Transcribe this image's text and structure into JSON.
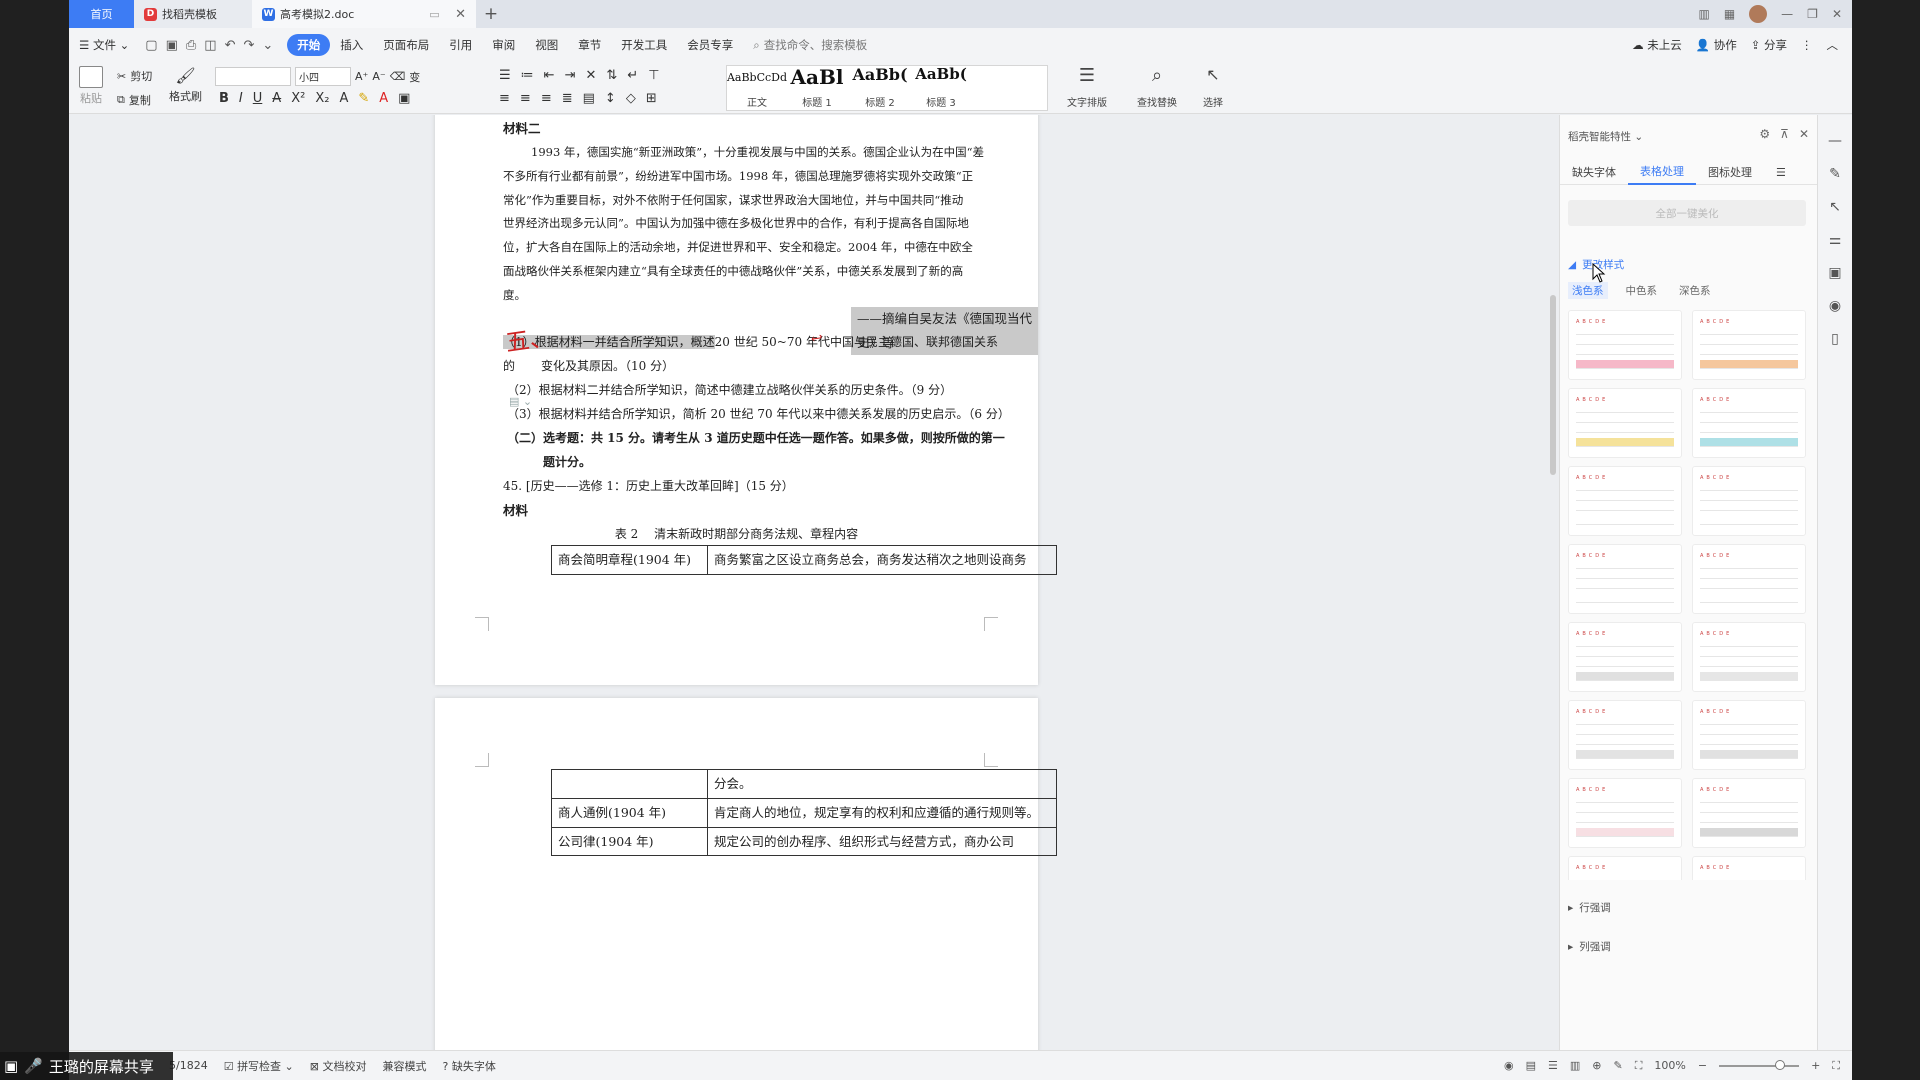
{
  "tabs": {
    "home": "首页",
    "tab1": "找稻壳模板",
    "tab2": "高考模拟2.doc"
  },
  "menu": {
    "file": "文件",
    "items": [
      "开始",
      "插入",
      "页面布局",
      "引用",
      "审阅",
      "视图",
      "章节",
      "开发工具",
      "会员专享"
    ],
    "search_placeholder": "查找命令、搜索模板",
    "cloud": "未上云",
    "collab": "协作",
    "share": "分享"
  },
  "ribbon": {
    "paste": "粘贴",
    "cut": "剪切",
    "copy": "复制",
    "format_painter": "格式刷",
    "font_size": "小四",
    "styles": [
      {
        "preview": "AaBbCcDd",
        "label": "正文"
      },
      {
        "preview": "AaBl",
        "label": "标题 1"
      },
      {
        "preview": "AaBb(",
        "label": "标题 2"
      },
      {
        "preview": "AaBb(",
        "label": "标题 3"
      }
    ],
    "text_layout": "文字排版",
    "find_replace": "查找替换",
    "select": "选择"
  },
  "document": {
    "material2_title": "材料二",
    "material2_lines": [
      "1993 年，德国实施“新亚洲政策”，十分重视发展与中国的关系。德国企业认为在中国“差",
      "不多所有行业都有前景”，纷纷进军中国市场。1998 年，德国总理施罗德将实现外交政策“正",
      "常化”作为重要目标，对外不依附于任何国家，谋求世界政治大国地位，并与中国共同“推动",
      "世界经济出现多元认同”。中国认为加强中德在多极化世界中的合作，有利于提高各自国际地",
      "位，扩大各自在国际上的活动余地，并促进世界和平、安全和稳定。2004 年，中德在中欧全",
      "面战略伙伴关系框架内建立“具有全球责任的中德战略伙伴”关系，中德关系发展到了新的高",
      "度。"
    ],
    "source": "——摘编自吴友法《德国现当代史》等",
    "q1_a": "（1）根据材料一并结合所学知识，概述",
    "q1_b": "20 世纪 50~70 年代中国与民主德国、联邦德国关系的",
    "q1_c": "变化及其原因。（10 分）",
    "q2": "（2）根据材料二并结合所学知识，简述中德建立战略伙伴关系的历史条件。（9 分）",
    "q3": "（3）根据材料并结合所学知识，简析 20 世纪 70 年代以来中德关系发展的历史启示。（6 分）",
    "elective_a": "（二）选考题：共 15 分。请考生从 3 道历史题中任选一题作答。如果多做，则按所做的第一",
    "elective_b": "题计分。",
    "q45": "45. [历史——选修 1：历史上重大改革回眸]（15 分）",
    "material": "材料",
    "table_caption": "表 2　 清末新政时期部分商务法规、章程内容",
    "table1_rows": [
      [
        "商会简明章程(1904 年)",
        "商务繁富之区设立商务总会，商务发达稍次之地则设商务"
      ]
    ],
    "table2_rows": [
      [
        "",
        "分会。"
      ],
      [
        "商人通例(1904 年)",
        "肯定商人的地位，规定享有的权利和应遵循的通行规则等。"
      ],
      [
        "公司律(1904 年)",
        "规定公司的创办程序、组织形式与经营方式，商办公司"
      ]
    ],
    "red_mark": "五、"
  },
  "panel": {
    "title": "稻壳智能特性",
    "tabs": [
      "缺失字体",
      "表格处理",
      "图标处理"
    ],
    "active_tab": "表格处理",
    "apply_button": "全部一键美化",
    "change_style": "更改样式",
    "subtabs": [
      "浅色系",
      "中色系",
      "深色系"
    ],
    "active_subtab": "浅色系",
    "row_emphasis": "行强调",
    "col_emphasis": "列强调",
    "thumb_colors": [
      "#f6b8c8",
      "#f5c79d",
      "#f5e29a",
      "#aee0e6",
      "#ffffff",
      "#ffffff",
      "#ffffff",
      "#ffffff",
      "#e0e0e0",
      "#e6e6e6",
      "#e3e3e3",
      "#e1e1e1",
      "#f7dfe3",
      "#d8d8d8",
      "#c9dfee",
      "#d8e8e0"
    ]
  },
  "status": {
    "page": "5/1824",
    "spellcheck": "拼写检查",
    "doc_check": "文档校对",
    "compat": "兼容模式",
    "missing_font": "缺失字体",
    "zoom": "100%"
  },
  "overlay": {
    "screen_share": "王璐的屏幕共享"
  }
}
